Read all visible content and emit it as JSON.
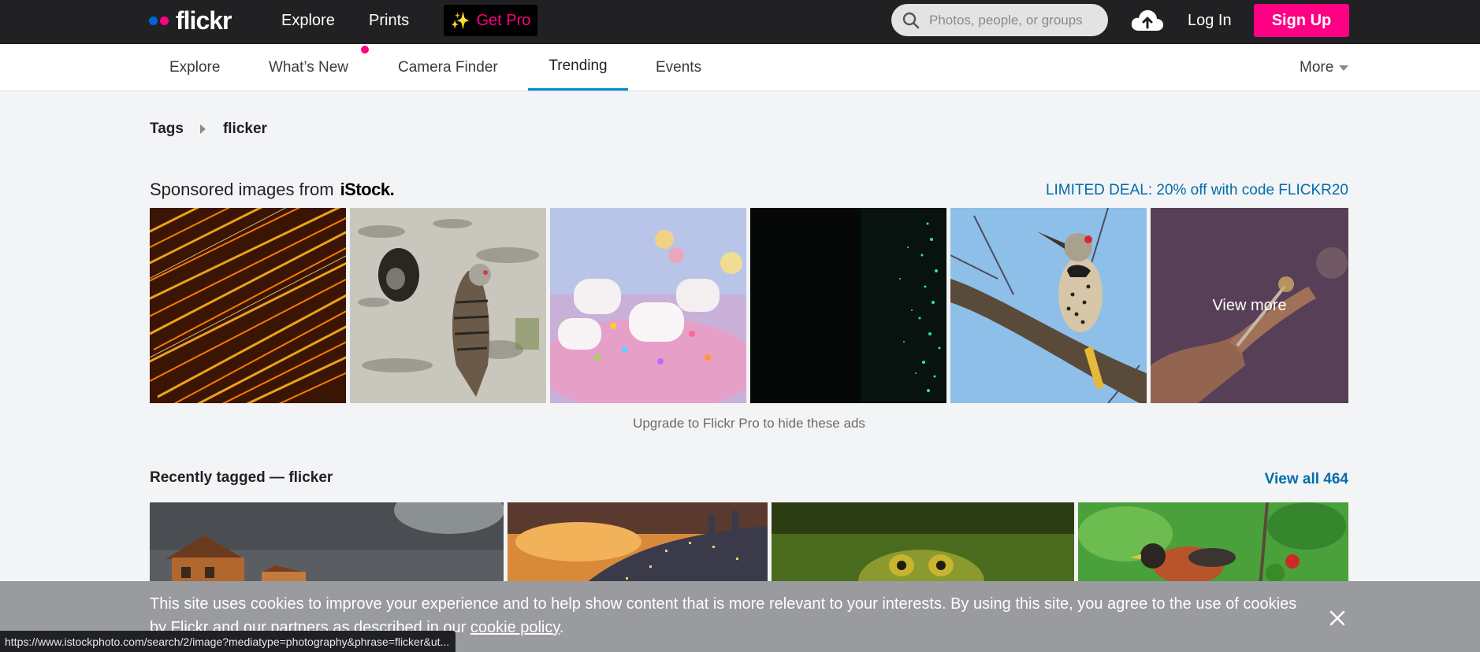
{
  "header": {
    "logo_text": "flickr",
    "nav": [
      {
        "label": "Explore"
      },
      {
        "label": "Prints"
      }
    ],
    "get_pro": {
      "label": "Get Pro",
      "icon": "sparkle-icon"
    },
    "search": {
      "placeholder": "Photos, people, or groups",
      "value": "",
      "icon": "search-icon"
    },
    "upload_icon": "cloud-upload-icon",
    "login_label": "Log In",
    "signup_label": "Sign Up",
    "colors": {
      "bar": "#212124",
      "brand_blue": "#0063dc",
      "brand_pink": "#ff0084"
    }
  },
  "subnav": {
    "items": [
      {
        "label": "Explore"
      },
      {
        "label": "What’s New"
      },
      {
        "label": "Camera Finder"
      },
      {
        "label": "Trending",
        "active": true
      },
      {
        "label": "Events"
      }
    ],
    "more_label": "More",
    "active_color": "#008ecf"
  },
  "breadcrumb": {
    "root": "Tags",
    "current": "flicker"
  },
  "sponsored": {
    "title_prefix": "Sponsored images from",
    "brand": "iStock.",
    "deal": "LIMITED DEAL: 20% off with code FLICKR20",
    "images": [
      {
        "subject": "orange light streaks"
      },
      {
        "subject": "woodpecker at nest hole in birch"
      },
      {
        "subject": "marshmallows and sprinkles"
      },
      {
        "subject": "green glowing particles on black"
      },
      {
        "subject": "northern flicker on branch"
      },
      {
        "subject": "hands holding sparkler"
      }
    ],
    "view_more_label": "View more",
    "upgrade_text": "Upgrade to Flickr Pro to hide these ads"
  },
  "recent": {
    "title": "Recently tagged — flicker",
    "view_all": "View all 464",
    "images": [
      {
        "subject": "wooden house under stormy sky"
      },
      {
        "subject": "hillside city at sunset"
      },
      {
        "subject": "green frog"
      },
      {
        "subject": "robin on branch with berries"
      }
    ]
  },
  "cookie": {
    "text": "This site uses cookies to improve your experience and to help show content that is more relevant to your interests. By using this site, you agree to the use of cookies by Flickr and our partners as described in our",
    "link": "cookie policy",
    "end": ".",
    "close_icon": "close-icon"
  },
  "status_url": "https://www.istockphoto.com/search/2/image?mediatype=photography&phrase=flicker&ut..."
}
